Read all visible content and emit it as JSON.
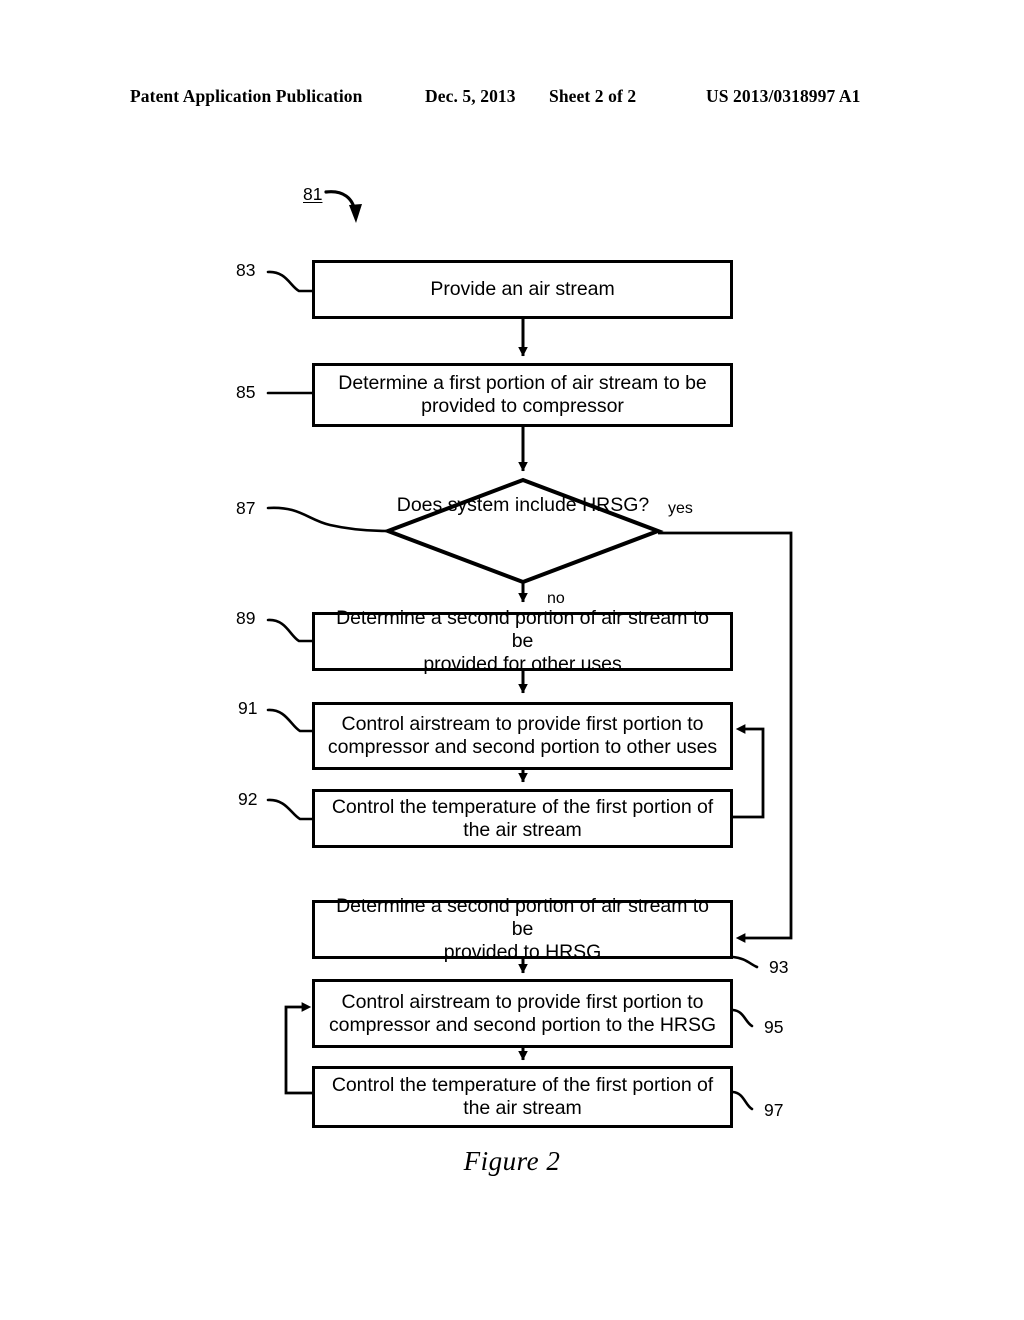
{
  "header": {
    "publication": "Patent Application Publication",
    "date": "Dec. 5, 2013",
    "sheet": "Sheet 2 of 2",
    "patent_number": "US 2013/0318997 A1"
  },
  "figure": {
    "caption": "Figure 2",
    "diagram_label": "81",
    "branch_yes": "yes",
    "branch_no": "no",
    "nodes": [
      {
        "ref": "83",
        "type": "process",
        "lines": [
          "Provide an air stream"
        ]
      },
      {
        "ref": "85",
        "type": "process",
        "lines": [
          "Determine  a first portion of air stream to be",
          "provided to compressor"
        ]
      },
      {
        "ref": "87",
        "type": "decision",
        "lines": [
          "Does system",
          "include",
          "HRSG?"
        ]
      },
      {
        "ref": "89",
        "type": "process",
        "lines": [
          "Determine a second portion of air stream to be",
          "provided for other uses"
        ]
      },
      {
        "ref": "91",
        "type": "process",
        "lines": [
          "Control airstream to provide first portion to",
          "compressor and  second portion to other uses"
        ]
      },
      {
        "ref": "92",
        "type": "process",
        "lines": [
          "Control the temperature of the first portion of",
          "the air stream"
        ]
      },
      {
        "ref": "93",
        "type": "process",
        "lines": [
          "Determine a second portion of air stream to be",
          "provided to HRSG"
        ]
      },
      {
        "ref": "95",
        "type": "process",
        "lines": [
          "Control airstream to provide first portion to",
          "compressor and  second portion to the HRSG"
        ]
      },
      {
        "ref": "97",
        "type": "process",
        "lines": [
          "Control the temperature of the first portion of",
          "the air stream"
        ]
      }
    ]
  },
  "colors": {
    "ink": "#000000",
    "paper": "#ffffff"
  }
}
